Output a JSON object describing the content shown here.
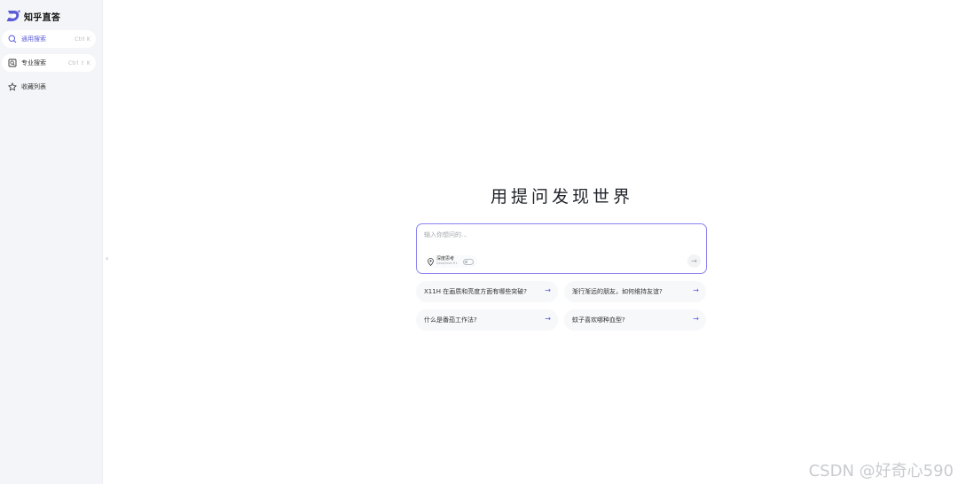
{
  "brand": {
    "name": "知乎直答",
    "accent": "#5b5bd6"
  },
  "sidebar": {
    "items": [
      {
        "label": "通用搜索",
        "shortcut": "Ctrl  K",
        "icon": "search-icon",
        "active": true
      },
      {
        "label": "专业搜索",
        "shortcut": "Ctrl  ⇧  K",
        "icon": "pro-search-icon",
        "active": false
      },
      {
        "label": "收藏列表",
        "shortcut": "",
        "icon": "star-icon",
        "active": false
      }
    ],
    "collapse_glyph": "‹"
  },
  "main": {
    "title": "用提问发现世界",
    "input_placeholder": "输入你想问的...",
    "deep_think": {
      "label": "深度思考",
      "sublabel": "DeepSeek R1",
      "enabled": false
    },
    "send_glyph": "→",
    "suggestions": [
      {
        "text": "X11H 在画质和亮度方面有哪些突破?",
        "arrow": "→"
      },
      {
        "text": "渐行渐远的朋友，如何维持友谊?",
        "arrow": "→"
      },
      {
        "text": "什么是番茄工作法?",
        "arrow": "→"
      },
      {
        "text": "蚊子喜欢哪种血型?",
        "arrow": "→"
      }
    ]
  },
  "watermark": "CSDN @好奇心590"
}
